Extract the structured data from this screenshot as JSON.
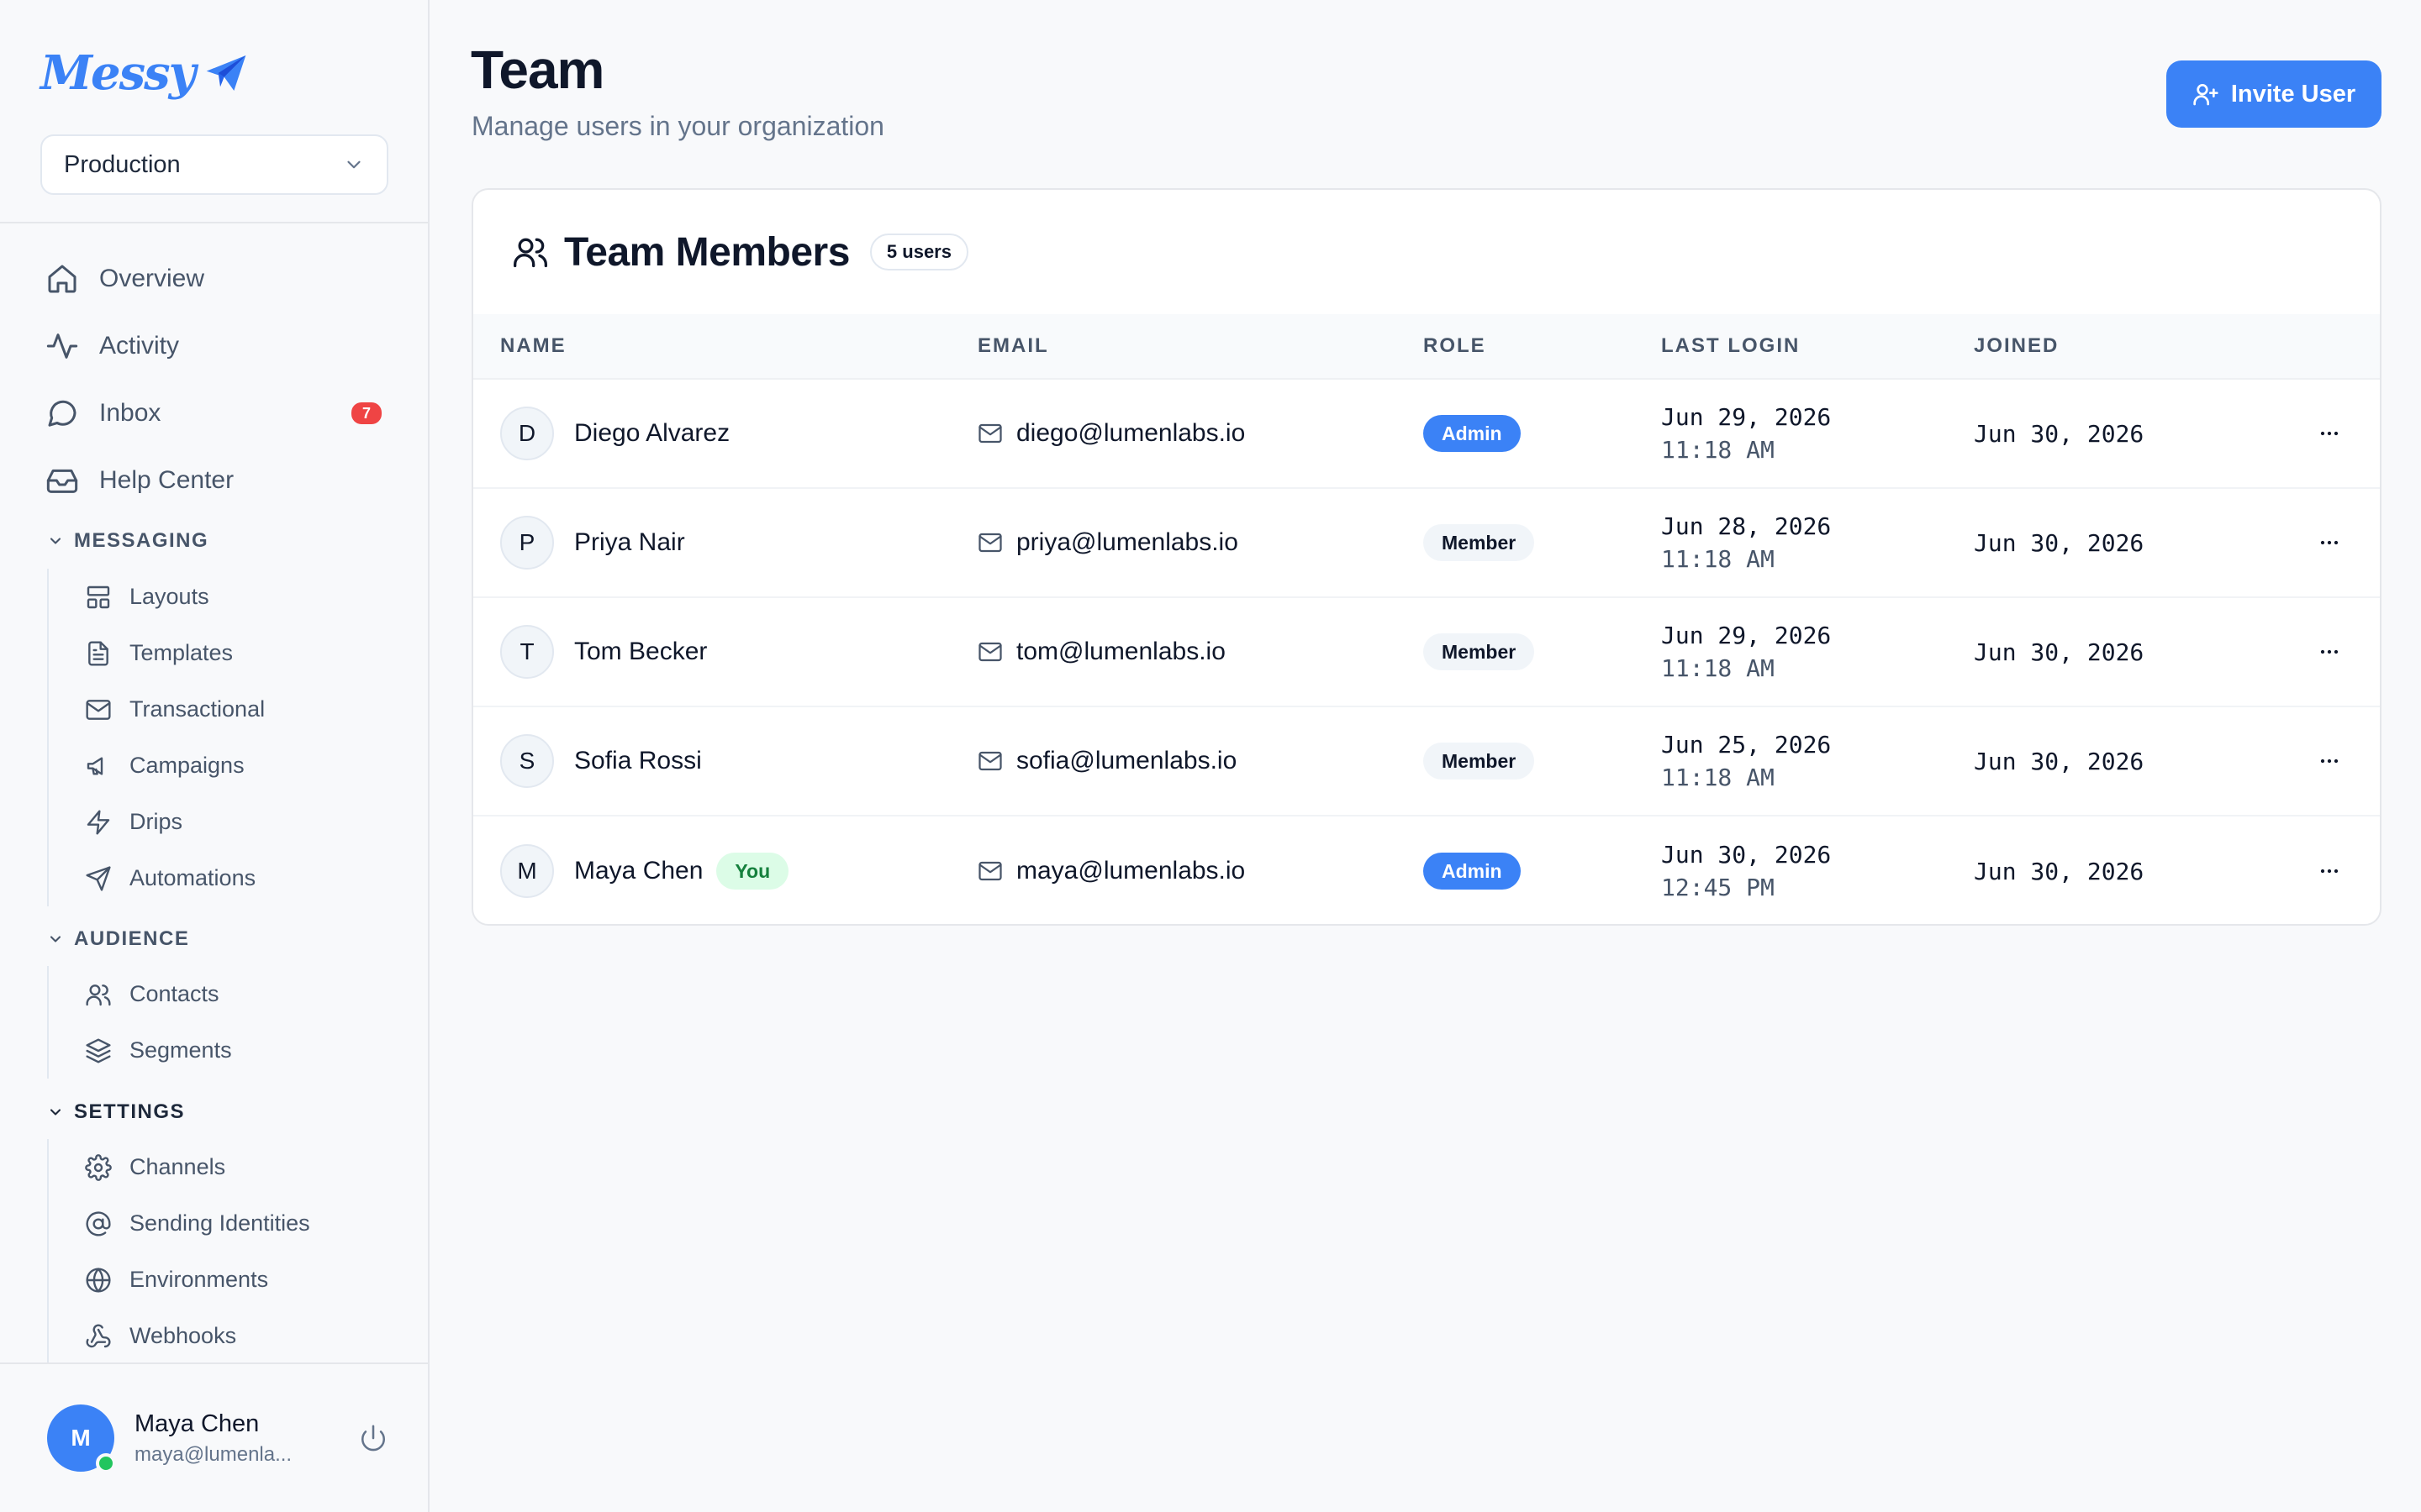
{
  "app": {
    "brand": "Messy"
  },
  "sidebar": {
    "env_select": {
      "value": "Production"
    },
    "main_nav": [
      {
        "label": "Overview",
        "icon": "home-icon"
      },
      {
        "label": "Activity",
        "icon": "activity-icon"
      },
      {
        "label": "Inbox",
        "icon": "message-icon",
        "badge": "7"
      },
      {
        "label": "Help Center",
        "icon": "inbox-tray-icon"
      }
    ],
    "sections": {
      "messaging": {
        "title": "MESSAGING",
        "items": [
          {
            "label": "Layouts",
            "icon": "layout-icon"
          },
          {
            "label": "Templates",
            "icon": "file-icon"
          },
          {
            "label": "Transactional",
            "icon": "mail-icon"
          },
          {
            "label": "Campaigns",
            "icon": "megaphone-icon"
          },
          {
            "label": "Drips",
            "icon": "zap-icon"
          },
          {
            "label": "Automations",
            "icon": "send-icon"
          }
        ]
      },
      "audience": {
        "title": "AUDIENCE",
        "items": [
          {
            "label": "Contacts",
            "icon": "users-icon"
          },
          {
            "label": "Segments",
            "icon": "layers-icon"
          }
        ]
      },
      "settings": {
        "title": "SETTINGS",
        "items": [
          {
            "label": "Channels",
            "icon": "gear-icon"
          },
          {
            "label": "Sending Identities",
            "icon": "at-sign-icon"
          },
          {
            "label": "Environments",
            "icon": "globe-icon"
          },
          {
            "label": "Webhooks",
            "icon": "webhook-icon"
          }
        ]
      }
    },
    "user": {
      "initial": "M",
      "name": "Maya Chen",
      "email": "maya@lumenla..."
    }
  },
  "header": {
    "title": "Team",
    "subtitle": "Manage users in your organization",
    "invite_button": "Invite User"
  },
  "team_card": {
    "title": "Team Members",
    "count": "5 users",
    "columns": [
      "NAME",
      "EMAIL",
      "ROLE",
      "LAST LOGIN",
      "JOINED"
    ],
    "rows": [
      {
        "initial": "D",
        "name": "Diego Alvarez",
        "you": "",
        "email": "diego@lumenlabs.io",
        "role": "Admin",
        "last_login_date": "Jun 29, 2026",
        "last_login_time": "11:18 AM",
        "joined": "Jun 30, 2026"
      },
      {
        "initial": "P",
        "name": "Priya Nair",
        "you": "",
        "email": "priya@lumenlabs.io",
        "role": "Member",
        "last_login_date": "Jun 28, 2026",
        "last_login_time": "11:18 AM",
        "joined": "Jun 30, 2026"
      },
      {
        "initial": "T",
        "name": "Tom Becker",
        "you": "",
        "email": "tom@lumenlabs.io",
        "role": "Member",
        "last_login_date": "Jun 29, 2026",
        "last_login_time": "11:18 AM",
        "joined": "Jun 30, 2026"
      },
      {
        "initial": "S",
        "name": "Sofia Rossi",
        "you": "",
        "email": "sofia@lumenlabs.io",
        "role": "Member",
        "last_login_date": "Jun 25, 2026",
        "last_login_time": "11:18 AM",
        "joined": "Jun 30, 2026"
      },
      {
        "initial": "M",
        "name": "Maya Chen",
        "you": "You",
        "email": "maya@lumenlabs.io",
        "role": "Admin",
        "last_login_date": "Jun 30, 2026",
        "last_login_time": "12:45 PM",
        "joined": "Jun 30, 2026"
      }
    ]
  },
  "colors": {
    "accent": "#3b82f6",
    "badge_red": "#ef4444",
    "online": "#22c55e",
    "you_bg": "#dcfce7",
    "you_text": "#15803d"
  }
}
